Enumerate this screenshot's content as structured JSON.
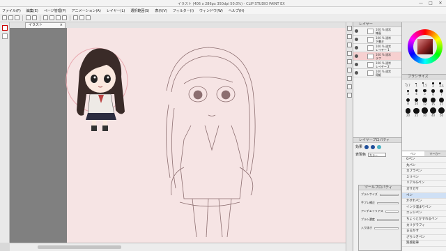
{
  "window": {
    "title": "イラスト (406 x 286px 350dpi 50.0%) - CLIP STUDIO PAINT EX"
  },
  "menu": [
    "ファイル(F)",
    "編集(E)",
    "ページ管理(P)",
    "アニメーション(A)",
    "レイヤー(L)",
    "選択範囲(S)",
    "表示(V)",
    "フィルター(I)",
    "ウィンドウ(W)",
    "ヘルプ(H)"
  ],
  "canvas_tab": {
    "label": "イラスト"
  },
  "layers": {
    "header": "レイヤー",
    "rows": [
      {
        "pct": "100 % 通常",
        "name": "線画"
      },
      {
        "pct": "100 % 通常",
        "name": "下書き"
      },
      {
        "pct": "100 % 通常",
        "name": "レイヤー 1"
      },
      {
        "pct": "100 % 通常",
        "name": "ラフ"
      },
      {
        "pct": "100 % 通常",
        "name": "レイヤー 2"
      },
      {
        "pct": "100 % 通常",
        "name": "用紙"
      }
    ]
  },
  "navigator": {
    "header": "レイヤープロパティ",
    "effect_label": "効果",
    "color_label": "表現色",
    "color_value": "カラー"
  },
  "props": {
    "header": "ツールプロパティ",
    "rows": [
      "ブラシサイズ",
      "手ブレ補正",
      "アンチエイリアス",
      "ブラシ濃度",
      "入り抜き"
    ]
  },
  "brush_size": {
    "header": "ブラシサイズ",
    "labels": [
      "0.7",
      "1",
      "1.5",
      "2",
      "2.5",
      "3",
      "4",
      "5",
      "6",
      "7",
      "8",
      "10",
      "12",
      "15",
      "17",
      "20",
      "25",
      "30",
      "40",
      "50"
    ]
  },
  "subtool": {
    "tabs": [
      "ペン",
      "マーカー"
    ],
    "items": [
      "Gペン",
      "丸ペン",
      "カブラペン",
      "ミリペン",
      "リアルGペン",
      "ガサガサ",
      "ペン",
      "かすれペン",
      "インク溜まりペン",
      "エッジペン",
      "ちょっとかすれるペン",
      "カリグラフィ",
      "まるかす",
      "ざらつきペン",
      "質感鉛筆"
    ],
    "selected": 6
  },
  "colors": {
    "canvas": "#f6e4e4",
    "workspace": "#808080",
    "accent": "#cfe0f5",
    "active_layer": "#f6d0d0"
  },
  "icons": [
    "pen-icon",
    "eraser-icon",
    "fill-icon",
    "move-icon",
    "zoom-icon",
    "eye-icon",
    "color-wheel-icon"
  ]
}
